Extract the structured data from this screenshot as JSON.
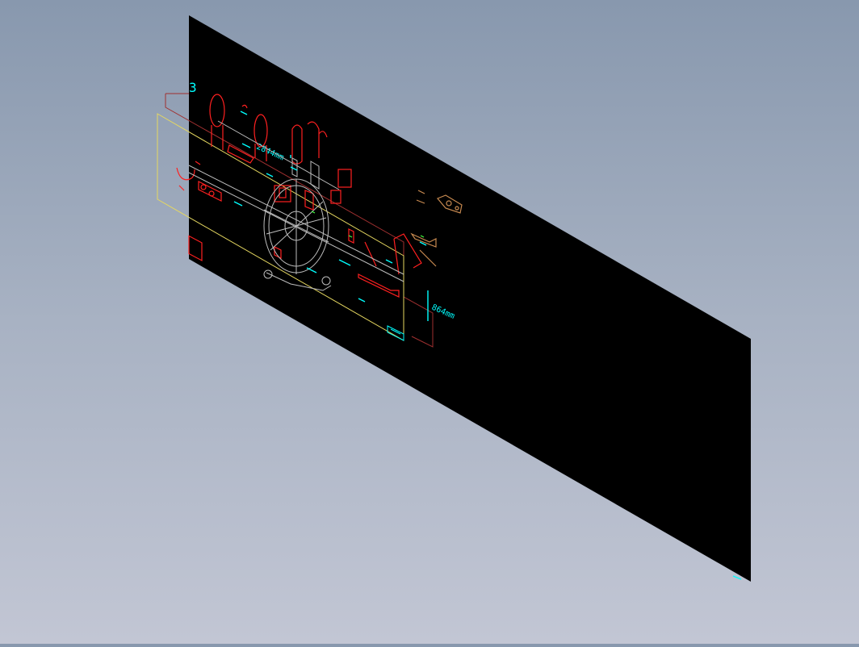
{
  "viewport": {
    "background_top": "#8898ae",
    "background_bottom": "#c2c6d4"
  },
  "drawing": {
    "sheet_color": "#000000",
    "colors": {
      "red": "#ff2020",
      "cyan": "#00ffff",
      "yellow": "#ffff66",
      "white": "#c8c8c8",
      "brown": "#c88a50",
      "green": "#40ff40"
    },
    "labels": {
      "corner_number": "3",
      "dimension_width": "2844mm",
      "dimension_height": "864mm"
    }
  }
}
